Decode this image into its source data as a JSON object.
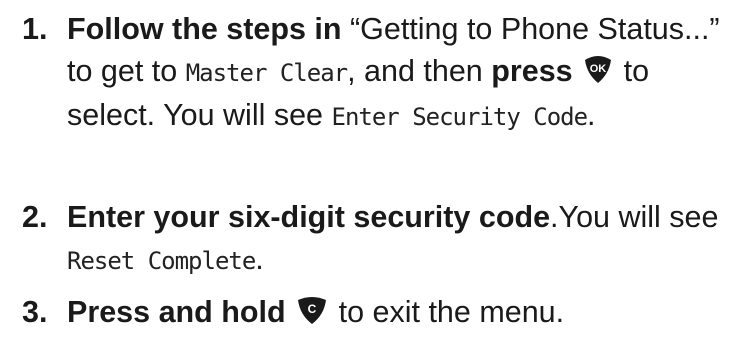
{
  "steps": [
    {
      "number": "1.",
      "lead_bold": "Follow the steps in",
      "text_a": " “Getting to Phone Status...” to get to ",
      "display_1": "Master Clear",
      "text_b": ", and then ",
      "bold_2": "press",
      "key_icon": "ok-key-icon",
      "key_label": "OK",
      "text_c": " to select. You will see ",
      "display_2": "Enter Security Code",
      "text_d": "."
    },
    {
      "number": "2.",
      "lead_bold": "Enter your six-digit security code",
      "text_a": ".You will see ",
      "display_1": "Reset Complete",
      "text_b": "."
    },
    {
      "number": "3.",
      "lead_bold": "Press and hold",
      "key_icon": "clear-key-icon",
      "key_label": "C",
      "text_a": " to exit the menu."
    }
  ],
  "colors": {
    "text": "#1a1a1a",
    "key_fill": "#1a1a1a",
    "key_label": "#ffffff"
  }
}
